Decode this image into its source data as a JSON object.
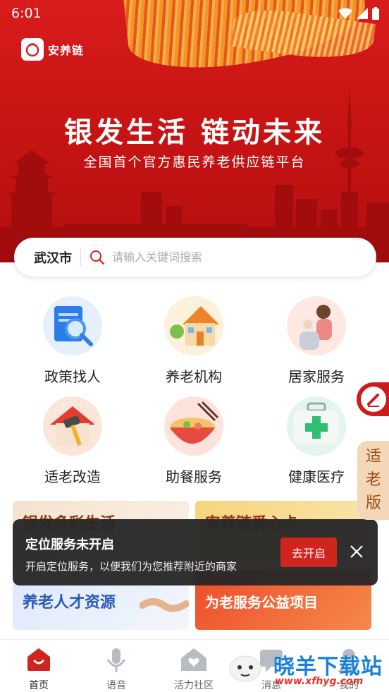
{
  "status_bar": {
    "time": "6:01"
  },
  "header": {
    "logo_text": "安养链",
    "slogan": "银发生活 链动未来",
    "subtitle": "全国首个官方惠民养老供应链平台"
  },
  "search": {
    "city": "武汉市",
    "placeholder": "请输入关键词搜索"
  },
  "services": [
    {
      "label": "政策找人",
      "icon": "policy-search-icon"
    },
    {
      "label": "养老机构",
      "icon": "nursing-home-icon"
    },
    {
      "label": "居家服务",
      "icon": "home-care-icon"
    },
    {
      "label": "适老改造",
      "icon": "renovation-icon"
    },
    {
      "label": "助餐服务",
      "icon": "meal-service-icon"
    },
    {
      "label": "健康医疗",
      "icon": "medical-kit-icon"
    }
  ],
  "banners": [
    {
      "text": "银发多彩生活"
    },
    {
      "text": "安养链爱心卡"
    },
    {
      "text": "养老人才资源"
    },
    {
      "text": "为老服务公益项目"
    }
  ],
  "toast": {
    "title": "定位服务未开启",
    "description": "开启定位服务，以便我们为您推荐附近的商家",
    "action": "去开启"
  },
  "side": {
    "elder_mode": [
      "适",
      "老",
      "版"
    ]
  },
  "tabbar": [
    {
      "label": "首页",
      "icon": "home-icon",
      "active": true
    },
    {
      "label": "语音",
      "icon": "microphone-icon",
      "active": false
    },
    {
      "label": "活力社区",
      "icon": "community-icon",
      "active": false
    },
    {
      "label": "消息",
      "icon": "message-icon",
      "active": false
    },
    {
      "label": "我的",
      "icon": "profile-icon",
      "active": false
    }
  ],
  "watermark": {
    "name": "晓羊下载站",
    "url": "www.xfhyg.com"
  },
  "colors": {
    "brand_red": "#d0241f",
    "hero_red": "#c81414",
    "elder_bg": "#f3d7b8"
  }
}
